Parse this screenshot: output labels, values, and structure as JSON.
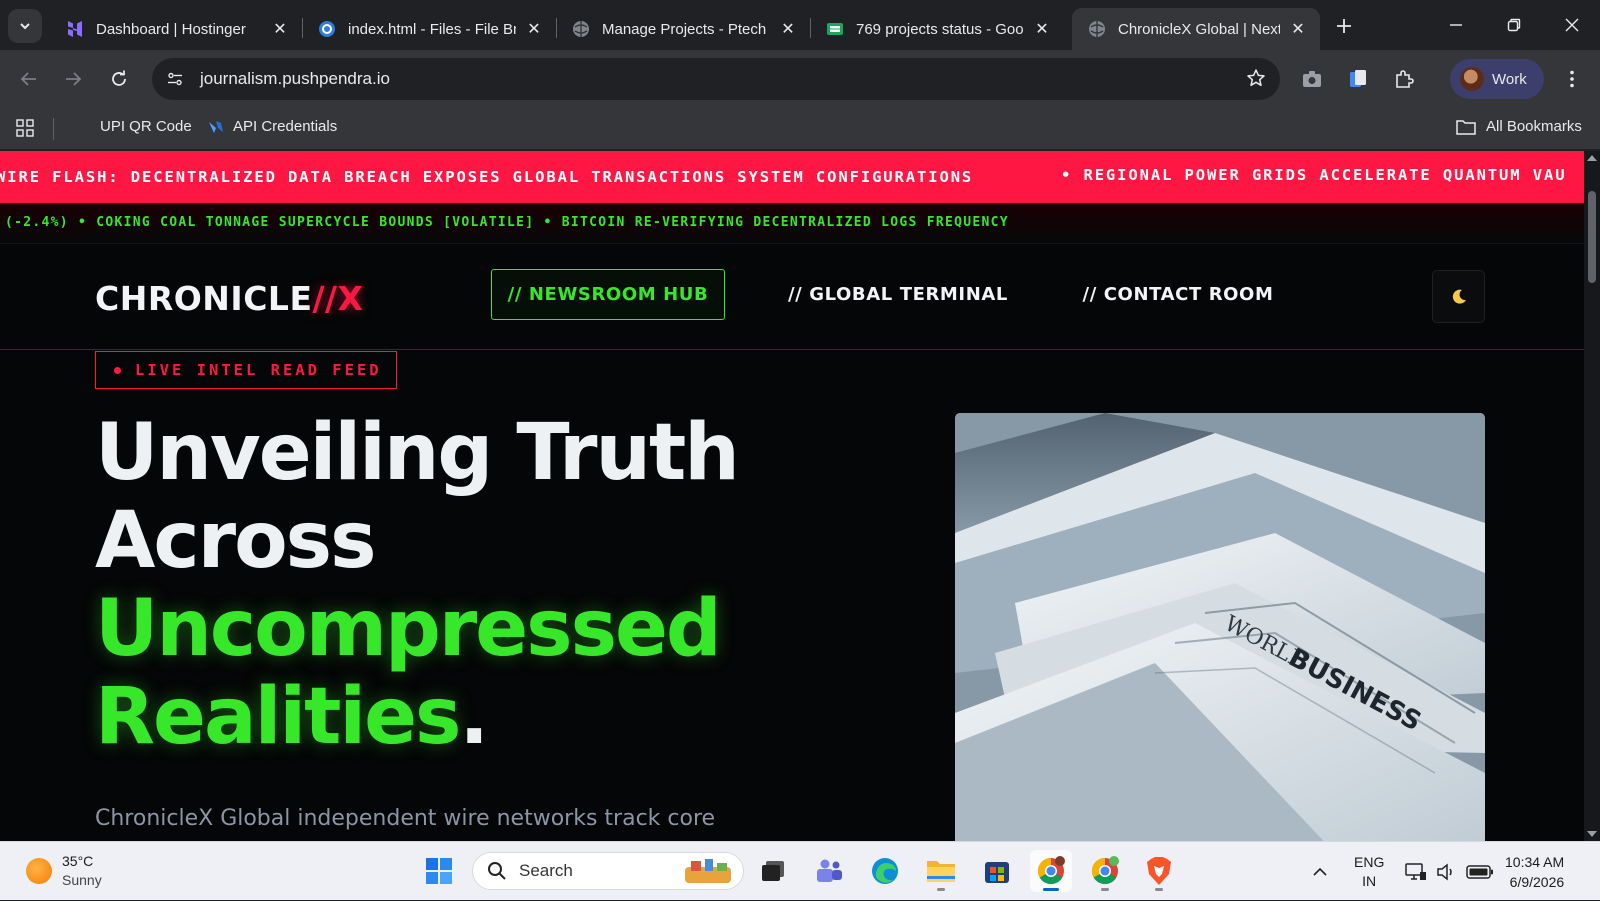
{
  "browser": {
    "tabs": [
      {
        "title": "Dashboard | Hostinger",
        "icon": "hostinger-icon"
      },
      {
        "title": "index.html - Files - File Br",
        "icon": "file-browser-icon"
      },
      {
        "title": "Manage Projects - Ptech",
        "icon": "globe-icon"
      },
      {
        "title": "769 projects status - Goo",
        "icon": "sheets-icon"
      },
      {
        "title": "ChronicleX Global | Next-",
        "icon": "globe-icon",
        "active": true
      }
    ],
    "url": "journalism.pushpendra.io",
    "profile_label": "Work",
    "bookmarks": [
      {
        "label": "UPI QR Code"
      },
      {
        "label": "API Credentials"
      }
    ],
    "all_bookmarks_label": "All Bookmarks"
  },
  "page": {
    "ticker_red": [
      "WIRE FLASH: DECENTRALIZED DATA BREACH EXPOSES GLOBAL TRANSACTIONS SYSTEM CONFIGURATIONS",
      "• REGIONAL POWER GRIDS ACCELERATE QUANTUM VAU"
    ],
    "ticker_green": "(-2.4%) • COKING COAL TONNAGE SUPERCYCLE BOUNDS [VOLATILE] • BITCOIN RE-VERIFYING DECENTRALIZED LOGS FREQUENCY",
    "logo": {
      "main": "CHRONICLE",
      "accent": "//X"
    },
    "nav": [
      {
        "label": "// NEWSROOM HUB",
        "active": true
      },
      {
        "label": "// GLOBAL TERMINAL"
      },
      {
        "label": "// CONTACT ROOM"
      }
    ],
    "badge": "LIVE INTEL READ FEED",
    "headline": {
      "line1": "Unveiling Truth",
      "line2": "Across",
      "line3": "Uncompressed",
      "line4": "Realities",
      "period": "."
    },
    "lead": "ChronicleX Global independent wire networks track core",
    "hero_image_text": {
      "line1": "WORLD",
      "line2": "BUSINESS"
    },
    "colors": {
      "accent_red": "#ff1744",
      "accent_green": "#37e82a",
      "background": "#050607"
    }
  },
  "taskbar": {
    "weather": {
      "temp": "35°C",
      "condition": "Sunny"
    },
    "search_placeholder": "Search",
    "lang": {
      "line1": "ENG",
      "line2": "IN"
    },
    "time": "10:34 AM",
    "date": "6/9/2026"
  }
}
